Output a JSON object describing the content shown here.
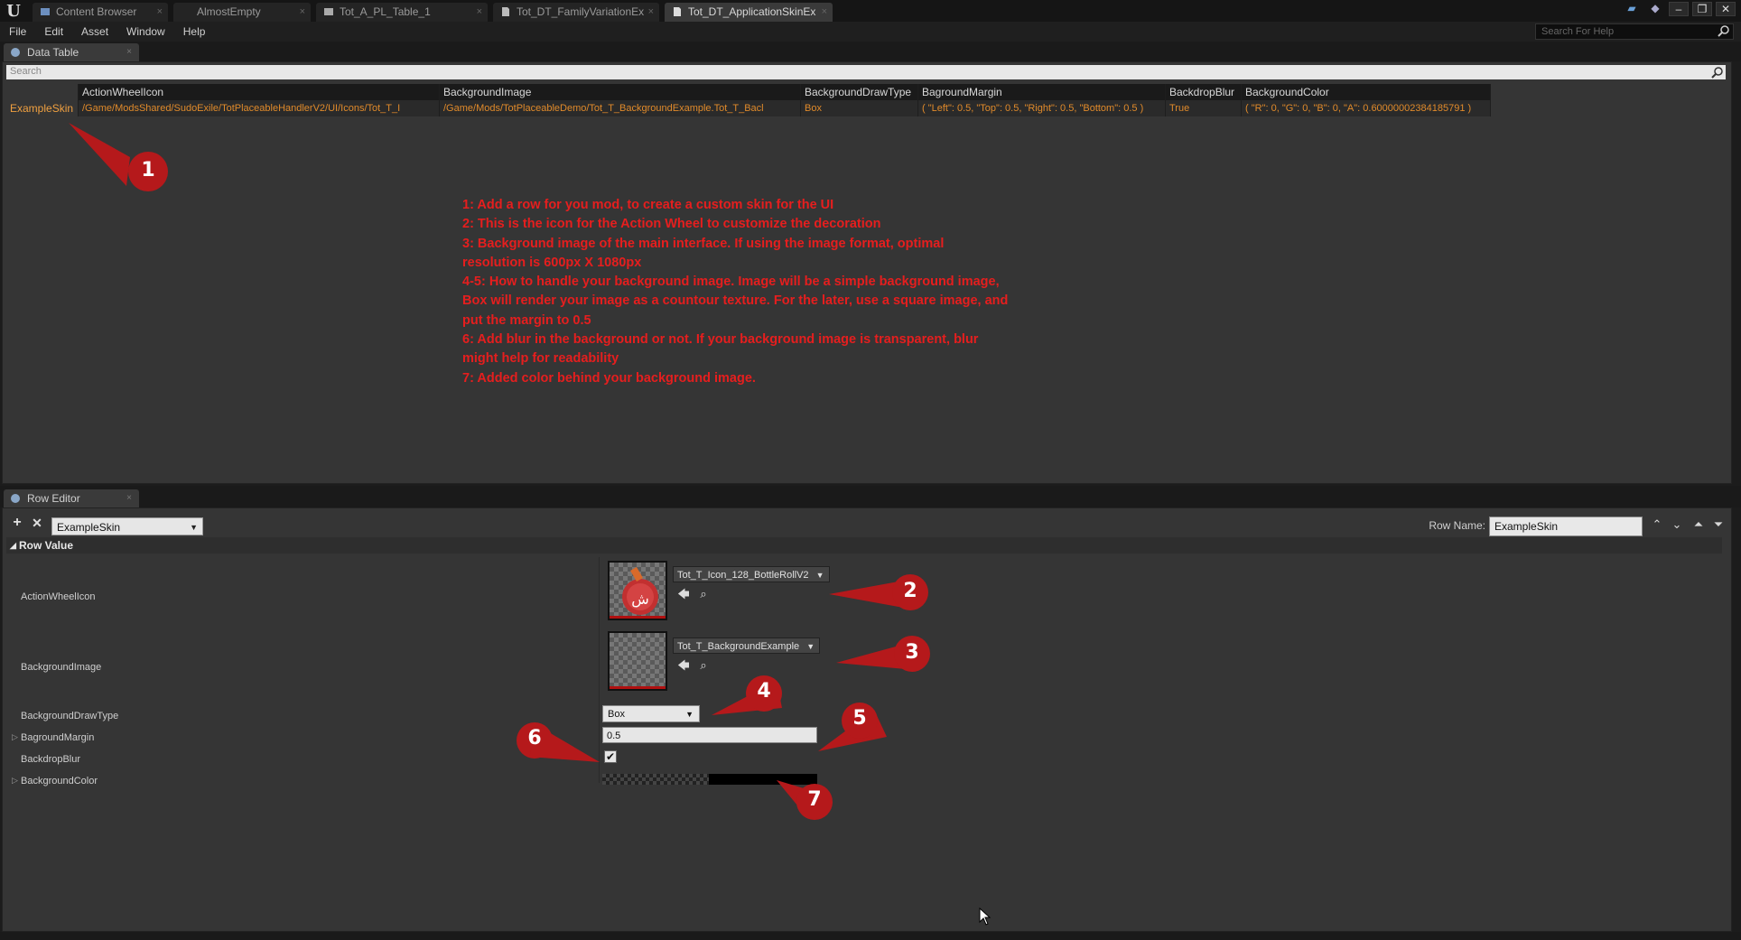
{
  "titlebar": {
    "tabs": [
      {
        "label": "Content Browser",
        "active": false
      },
      {
        "label": "AlmostEmpty",
        "active": false
      },
      {
        "label": "Tot_A_PL_Table_1",
        "active": false
      },
      {
        "label": "Tot_DT_FamilyVariationEx",
        "active": false
      },
      {
        "label": "Tot_DT_ApplicationSkinEx",
        "active": true
      }
    ]
  },
  "menubar": {
    "items": [
      "File",
      "Edit",
      "Asset",
      "Window",
      "Help"
    ],
    "search_placeholder": "Search For Help"
  },
  "data_table": {
    "tab_label": "Data Table",
    "search_placeholder": "Search",
    "columns": [
      "",
      "ActionWheelIcon",
      "BackgroundImage",
      "BackgroundDrawType",
      "BagroundMargin",
      "BackdropBlur",
      "BackgroundColor"
    ],
    "rows": [
      [
        "ExampleSkin",
        "/Game/ModsShared/SudoExile/TotPlaceableHandlerV2/UI/Icons/Tot_T_I",
        "/Game/Mods/TotPlaceableDemo/Tot_T_BackgroundExample.Tot_T_Bacl",
        "Box",
        "( \"Left\": 0.5, \"Top\": 0.5, \"Right\": 0.5, \"Bottom\": 0.5 )",
        "True",
        "( \"R\": 0, \"G\": 0, \"B\": 0, \"A\": 0.60000002384185791 )"
      ]
    ]
  },
  "instructions": [
    "1: Add a row for you mod, to create a custom skin for the UI",
    "2: This is the icon for the Action Wheel to customize the decoration",
    "3: Background image of the main interface. If using the image format, optimal\nresolution is 600px X 1080px",
    "4-5: How to handle your background image. Image will be a simple background image,\nBox will render your image as a countour texture. For the later, use a square image, and\nput the margin to 0.5",
    "6: Add blur in the background or not. If your background image is transparent, blur\nmight help for readability",
    "7: Added color behind your background image."
  ],
  "row_editor": {
    "tab_label": "Row Editor",
    "selected_row": "ExampleSkin",
    "row_name_label": "Row Name:",
    "row_name_value": "ExampleSkin",
    "section_label": "Row Value",
    "properties": {
      "action_wheel_icon": {
        "label": "ActionWheelIcon",
        "asset": "Tot_T_Icon_128_BottleRollV2"
      },
      "background_image": {
        "label": "BackgroundImage",
        "asset": "Tot_T_BackgroundExample"
      },
      "draw_type": {
        "label": "BackgroundDrawType",
        "value": "Box"
      },
      "margin": {
        "label": "BagroundMargin",
        "value": "0.5"
      },
      "blur": {
        "label": "BackdropBlur",
        "checked": true
      },
      "color": {
        "label": "BackgroundColor"
      }
    }
  },
  "callouts": [
    "1",
    "2",
    "3",
    "4",
    "5",
    "6",
    "7"
  ],
  "colors": {
    "accent_red": "#b5191b",
    "instruction_red": "#e61e1e",
    "row_name_orange": "#f0a040"
  }
}
